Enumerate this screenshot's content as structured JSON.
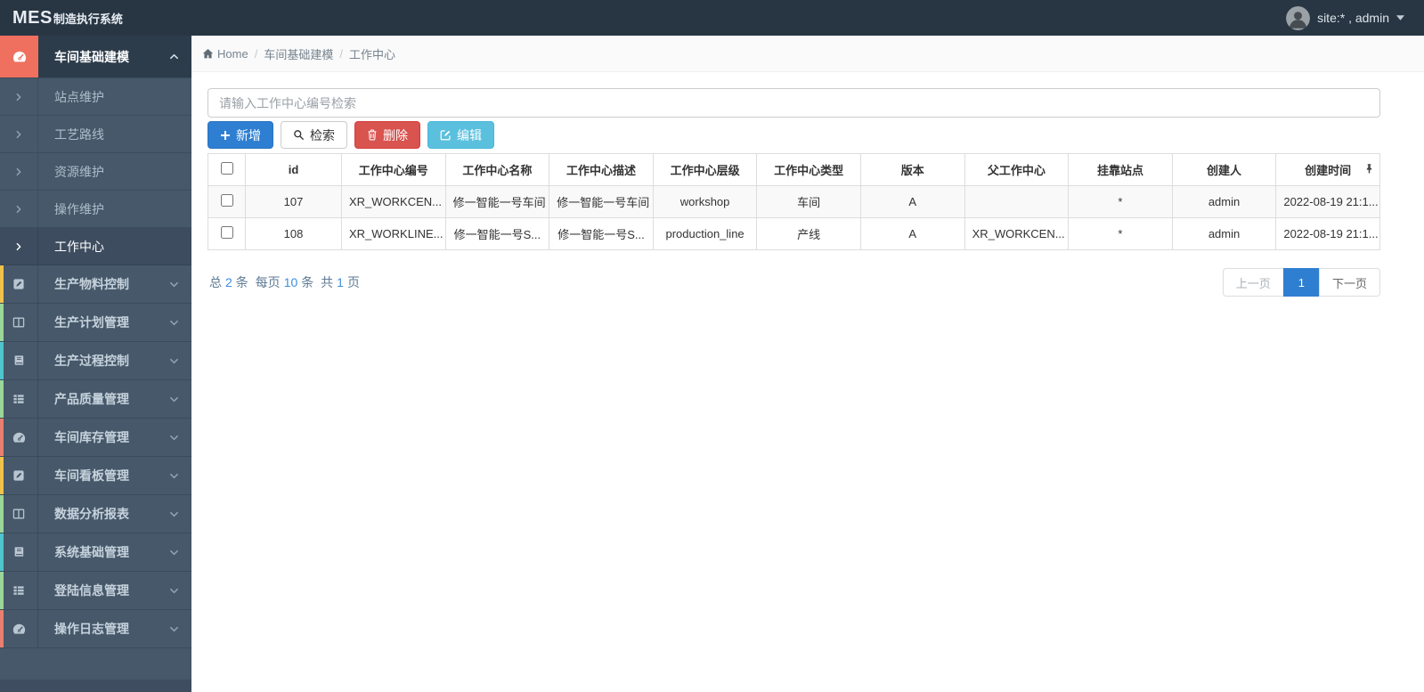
{
  "navbar": {
    "brand_bold": "MES",
    "brand_sub": "制造执行系统",
    "user_label": "site:* , admin"
  },
  "breadcrumb": {
    "home": "Home",
    "level1": "车间基础建模",
    "level2": "工作中心"
  },
  "sidebar": {
    "active_group": {
      "label": "车间基础建模",
      "icon": "gauge-icon"
    },
    "submenu": {
      "items": [
        {
          "label": "站点维护"
        },
        {
          "label": "工艺路线"
        },
        {
          "label": "资源维护"
        },
        {
          "label": "操作维护"
        },
        {
          "label": "工作中心",
          "active": true
        }
      ]
    },
    "groups": [
      {
        "label": "生产物料控制",
        "icon": "pencil-square-icon",
        "strip": "#f0c24b"
      },
      {
        "label": "生产计划管理",
        "icon": "columns-icon",
        "strip": "#9ad69a"
      },
      {
        "label": "生产过程控制",
        "icon": "book-icon",
        "strip": "#4fc4cd"
      },
      {
        "label": "产品质量管理",
        "icon": "th-list-icon",
        "strip": "#9ad69a"
      },
      {
        "label": "车间库存管理",
        "icon": "gauge-icon",
        "strip": "#e97f72"
      },
      {
        "label": "车间看板管理",
        "icon": "pencil-square-icon",
        "strip": "#f0c24b"
      },
      {
        "label": "数据分析报表",
        "icon": "columns-icon",
        "strip": "#9ad69a"
      },
      {
        "label": "系统基础管理",
        "icon": "book-icon",
        "strip": "#4fc4cd"
      },
      {
        "label": "登陆信息管理",
        "icon": "th-list-icon",
        "strip": "#9ad69a"
      },
      {
        "label": "操作日志管理",
        "icon": "gauge-icon",
        "strip": "#e97f72"
      }
    ]
  },
  "search": {
    "placeholder": "请输入工作中心编号检索",
    "value": ""
  },
  "toolbar": {
    "add_label": "新增",
    "search_label": "检索",
    "delete_label": "删除",
    "edit_label": "编辑"
  },
  "table": {
    "columns": [
      "id",
      "工作中心编号",
      "工作中心名称",
      "工作中心描述",
      "工作中心层级",
      "工作中心类型",
      "版本",
      "父工作中心",
      "挂靠站点",
      "创建人",
      "创建时间"
    ],
    "rows": [
      {
        "cells": [
          "107",
          "XR_WORKCEN...",
          "修一智能一号车间",
          "修一智能一号车间",
          "workshop",
          "车间",
          "A",
          "",
          "*",
          "admin",
          "2022-08-19 21:1..."
        ]
      },
      {
        "cells": [
          "108",
          "XR_WORKLINE...",
          "修一智能一号S...",
          "修一智能一号S...",
          "production_line",
          "产线",
          "A",
          "XR_WORKCEN...",
          "*",
          "admin",
          "2022-08-19 21:1..."
        ]
      }
    ]
  },
  "pagination": {
    "summary": [
      "总",
      "2",
      "条",
      "每页",
      "10",
      "条",
      "共",
      "1",
      "页"
    ],
    "prev": "上一页",
    "current": "1",
    "next": "下一页"
  },
  "colors": {
    "navbar_bg": "#283644",
    "sidebar_bg": "#46586a",
    "active_icon_red": "#ef705f",
    "active_label_bg": "#2d3c4b",
    "primary_blue": "#2e7fd2",
    "danger_red": "#d9534f",
    "info_cyan": "#5bc0de",
    "strip_yellow": "#f0c24b",
    "strip_green": "#9ad69a",
    "strip_teal": "#4fc4cd",
    "strip_red": "#e97f72",
    "pagination_active": "#2e7fd2"
  },
  "icons": {
    "gauge": "speedometer semicircle with needle",
    "pencil-square": "filled square with pencil",
    "columns": "split rectangle",
    "book": "book",
    "th-list": "list with blocks",
    "home": "house",
    "search": "magnifier",
    "plus": "plus sign",
    "trash": "trash can",
    "edit": "square with pencil",
    "pin": "thumbtack",
    "chevron": "angle arrow"
  }
}
